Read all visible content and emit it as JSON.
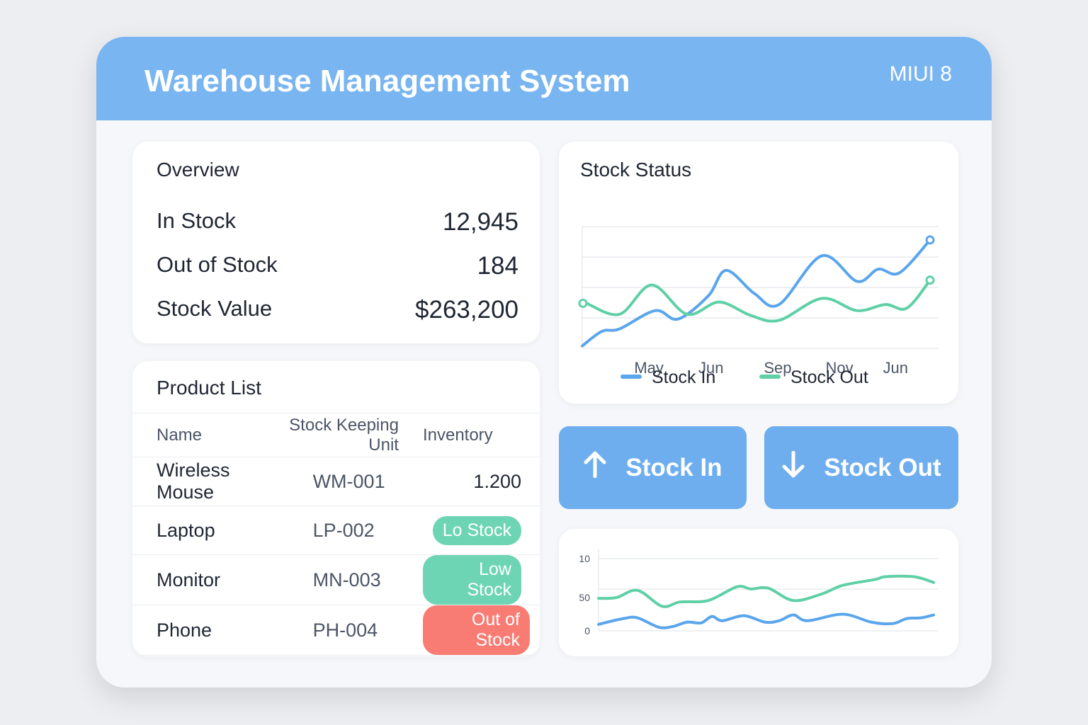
{
  "header": {
    "title": "Warehouse Management System",
    "version": "MIUI 8"
  },
  "overview": {
    "title": "Overview",
    "rows": [
      {
        "label": "In Stock",
        "value": "12,945"
      },
      {
        "label": "Out of Stock",
        "value": "184"
      },
      {
        "label": "Stock Value",
        "value": "$263,200"
      }
    ]
  },
  "products": {
    "title": "Product List",
    "columns": [
      "Name",
      "Stock Keeping Unit",
      "Inventory"
    ],
    "rows": [
      {
        "name": "Wireless Mouse",
        "sku": "WM-001",
        "inventory": "1.200"
      },
      {
        "name": "Laptop",
        "sku": "LP-002",
        "inventory": "Lo Stock",
        "status": "low"
      },
      {
        "name": "Monitor",
        "sku": "MN-003",
        "inventory": "Low Stock",
        "status": "low"
      },
      {
        "name": "Phone",
        "sku": "PH-004",
        "inventory": "Out of Stock",
        "status": "out"
      }
    ]
  },
  "colors": {
    "accent": "#79b5f0",
    "stock_in": "#5aa5ec",
    "stock_out": "#5fd0a6",
    "low": "#6dd5b3",
    "out": "#f87c74"
  },
  "buttons": {
    "stock_in": "Stock In",
    "stock_out": "Stock Out"
  },
  "chart_data": [
    {
      "type": "line",
      "title": "Stock Status",
      "xlim": [
        0,
        10
      ],
      "ylim": [
        0,
        100
      ],
      "grid": true,
      "legend": "bottom",
      "x_ticks": [
        {
          "x": 1.89,
          "label": "May"
        },
        {
          "x": 3.65,
          "label": "Jun"
        },
        {
          "x": 5.54,
          "label": "Sep"
        },
        {
          "x": 7.29,
          "label": "Nov"
        },
        {
          "x": 8.88,
          "label": "Jun"
        }
      ],
      "series": [
        {
          "name": "Stock In",
          "color": "#5aa5ec",
          "x": [
            0,
            0.56,
            1.06,
            2.07,
            2.71,
            3.57,
            4.08,
            4.88,
            5.58,
            6.79,
            7.79,
            8.39,
            8.99,
            9.86
          ],
          "y": [
            2,
            14,
            16,
            31,
            24,
            43,
            64,
            45,
            36,
            76,
            55,
            65,
            62,
            89
          ]
        },
        {
          "name": "Stock Out",
          "color": "#5fd0a6",
          "x": [
            0.12,
            1.06,
            1.97,
            2.97,
            3.88,
            4.78,
            5.58,
            6.79,
            7.79,
            8.59,
            9.2,
            9.86
          ],
          "y": [
            37,
            28,
            52,
            28,
            38,
            27,
            23,
            41,
            31,
            36,
            33,
            56
          ]
        }
      ]
    },
    {
      "type": "line",
      "title": "",
      "xlim": [
        0,
        10
      ],
      "ylim": [
        0,
        100
      ],
      "grid": true,
      "y_ticks": [
        {
          "y": 100,
          "label": "10"
        },
        {
          "y": 46,
          "label": "50"
        },
        {
          "y": 0,
          "label": "0"
        }
      ],
      "series": [
        {
          "name": "Stock Out",
          "color": "#5fd0a6",
          "x": [
            0,
            0.53,
            1.16,
            1.89,
            2.42,
            3.26,
            4.11,
            4.53,
            5.05,
            5.79,
            6.63,
            7.26,
            8.21,
            8.53,
            9.37,
            9.96
          ],
          "y": [
            45,
            46,
            56,
            34,
            40,
            42,
            61,
            58,
            59,
            42,
            51,
            63,
            71,
            75,
            75,
            67
          ]
        },
        {
          "name": "Stock In",
          "color": "#5aa5ec",
          "x": [
            0,
            0.74,
            1.16,
            1.79,
            2.21,
            2.63,
            3.05,
            3.37,
            3.68,
            4.32,
            4.95,
            5.37,
            5.79,
            6.21,
            7.26,
            8.11,
            8.74,
            9.16,
            9.58,
            9.96
          ],
          "y": [
            9,
            17,
            18,
            5,
            6,
            12,
            11,
            20,
            14,
            21,
            12,
            14,
            22,
            14,
            23,
            12,
            10,
            17,
            18,
            22
          ]
        }
      ]
    }
  ]
}
